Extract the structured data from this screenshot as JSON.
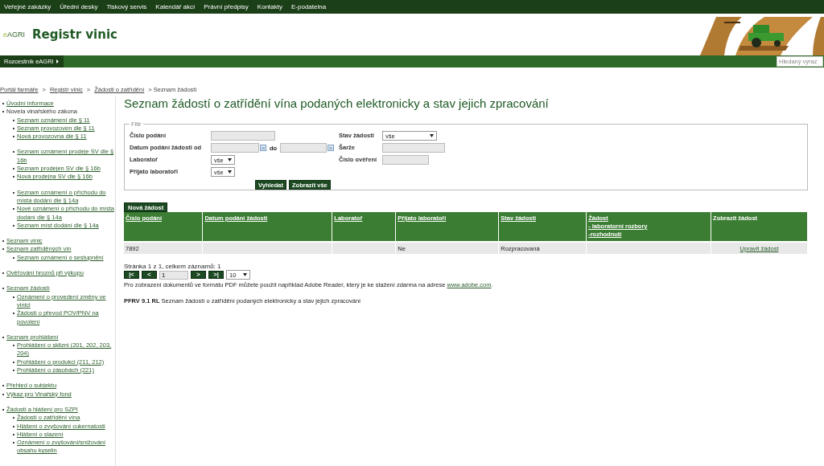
{
  "top_nav": [
    "Veřejné zakázky",
    "Úřední desky",
    "Tiskový servis",
    "Kalendář akcí",
    "Právní předpisy",
    "Kontakty",
    "E-podatelna"
  ],
  "header": {
    "logo_prefix": "e",
    "logo": "AGRI",
    "title": "Registr vinic"
  },
  "subnav": {
    "item": "Rozcestník eAGRI",
    "search_placeholder": "Hledaný výraz"
  },
  "breadcrumb": [
    {
      "label": "Portál farmáře",
      "link": true
    },
    {
      "label": ">",
      "link": false
    },
    {
      "label": "Registr vinic",
      "link": true
    },
    {
      "label": ">",
      "link": false
    },
    {
      "label": "Žádosti o zatřídění",
      "link": true
    },
    {
      "label": "> Seznam žádostí",
      "link": false
    }
  ],
  "sidebar": {
    "sections": [
      [
        {
          "label": "Úvodní informace",
          "link": true
        },
        {
          "label": "Novela vinařského zákona",
          "link": false,
          "child_groups": [
            [
              "Seznam oznámení dle § 11",
              "Seznam provozoven dle § 11",
              "Nová provozovna dle § 11"
            ],
            [
              "Seznam oznámení prodeje SV dle § 16b",
              "Seznam prodejen SV dle § 16b",
              "Nová prodejna SV dle § 16b"
            ],
            [
              "Seznam oznámení o příchodu do místa dodání dle § 14a",
              "Nové oznámení o příchodu do místa dodání dle § 14a",
              "Seznam míst dodání dle § 14a"
            ]
          ]
        }
      ],
      [
        {
          "label": "Seznam vinic",
          "link": true
        },
        {
          "label": "Seznam zatříděných vín",
          "link": true,
          "child_groups": [
            [
              "Seznam oznámení o sestupnění"
            ]
          ]
        }
      ],
      [
        {
          "label": "Ověřování hroznů při výkupu",
          "link": true
        }
      ],
      [
        {
          "label": "Seznam žádostí",
          "link": true,
          "child_groups": [
            [
              "Oznámení o provedení změny ve vinici",
              "Žádosti o převod POV/PNV na povolení"
            ]
          ]
        }
      ],
      [
        {
          "label": "Seznam prohlášení",
          "link": true,
          "child_groups": [
            [
              "Prohlášení o sklizni (201, 202, 203, 204)",
              "Prohlášení o produkci (211, 212)",
              "Prohlášení o zásobách (221)"
            ]
          ]
        }
      ],
      [
        {
          "label": "Přehled o subjektu",
          "link": true
        },
        {
          "label": "Výkaz pro Vinařský fond",
          "link": true
        }
      ],
      [
        {
          "label": "Žádosti a hlášení pro SZPI",
          "link": true,
          "child_groups": [
            [
              "Žádosti o zatřídění vína",
              "Hlášení o zvyšování cukernatosti",
              "Hlášení o slazení",
              "Oznámení o zvyšování/snižování obsahu kyselin"
            ]
          ]
        }
      ]
    ]
  },
  "page_title": "Seznam žádostí o zatřídění vína podaných elektronicky a stav jejich zpracování",
  "filter": {
    "legend": "Filtr",
    "left": [
      {
        "label": "Číslo podání",
        "kind": "text"
      },
      {
        "label": "Datum podání žádosti od",
        "kind": "date_range",
        "between": "do"
      },
      {
        "label": "Laboratoř",
        "kind": "select",
        "value": "vše"
      },
      {
        "label": "Přijato laboratoři",
        "kind": "select",
        "value": "vše"
      }
    ],
    "right": [
      {
        "label": "Stav žádosti",
        "kind": "select_wide",
        "value": "vše"
      },
      {
        "label": "Šarže",
        "kind": "text"
      },
      {
        "label": "Číslo ověření",
        "kind": "text_short"
      }
    ],
    "buttons": [
      "Vyhledat",
      "Zobrazit vše"
    ]
  },
  "new_button": "Nová žádost",
  "table": {
    "columns": [
      {
        "lines": [
          "Číslo podání"
        ],
        "link": true
      },
      {
        "lines": [
          "Datum podání žádosti"
        ],
        "link": true
      },
      {
        "lines": [
          "Laboratoř"
        ],
        "link": true
      },
      {
        "lines": [
          "Přijato laboratoří"
        ],
        "link": true
      },
      {
        "lines": [
          "Stav žádosti"
        ],
        "link": true
      },
      {
        "lines": [
          "Žádost",
          "- laboratorní rozbory",
          "-rozhodnutí"
        ],
        "link": true
      },
      {
        "lines": [
          "Zobrazit žádost"
        ],
        "link": false
      }
    ],
    "rows": [
      {
        "cells": [
          "7892",
          "",
          "",
          "Ne",
          "Rozpracovaná",
          ""
        ],
        "action": "Upravit žádost"
      }
    ]
  },
  "pager": {
    "summary": "Stránka 1 z 1, celkem záznamů: 1",
    "first": "|<",
    "prev": "<",
    "page": "1",
    "next": ">",
    "last": ">|",
    "page_size": "10"
  },
  "note": {
    "text": "Pro zobrazení dokumentů ve formátu PDF můžete použít například Adobe Reader, který je ke stažení zdarma na adrese",
    "link": "www.adobe.com",
    "end": "."
  },
  "footer": {
    "code": "PFRV 9.1 RL",
    "text": "Seznam žádostí o zatřídění podaných elektronicky a stav jejich zpracování"
  }
}
